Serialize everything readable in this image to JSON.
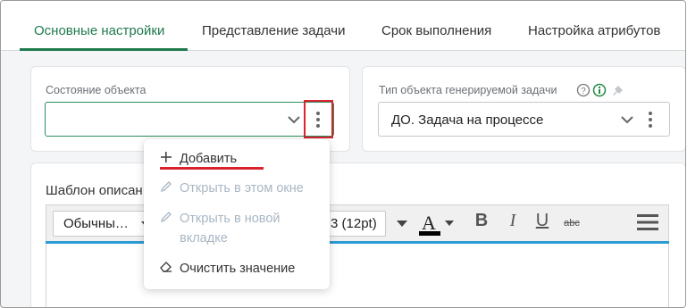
{
  "tabs": [
    {
      "label": "Основные настройки",
      "active": true
    },
    {
      "label": "Представление задачи",
      "active": false
    },
    {
      "label": "Срок выполнения",
      "active": false
    },
    {
      "label": "Настройка атрибутов",
      "active": false
    }
  ],
  "object_state": {
    "label": "Состояние объекта",
    "value": ""
  },
  "task_type": {
    "label": "Тип объекта генерируемой задачи",
    "value": "ДО. Задача на процессе"
  },
  "template": {
    "label": "Шаблон описан"
  },
  "editor_toolbar": {
    "style_value": "Обычны…",
    "size_value": "3 (12pt)",
    "font_color_letter": "A",
    "bold": "B",
    "italic": "I",
    "underline": "U",
    "strike": "abc"
  },
  "context_menu": {
    "items": [
      {
        "label": "Добавить",
        "icon": "plus-icon",
        "disabled": false
      },
      {
        "label": "Открыть в этом окне",
        "icon": "pencil-icon",
        "disabled": true
      },
      {
        "label": "Открыть в новой вкладке",
        "icon": "pencil-icon",
        "disabled": true
      },
      {
        "label": "Очистить значение",
        "icon": "eraser-icon",
        "disabled": false
      }
    ]
  },
  "colors": {
    "accent_green": "#1f7a4d",
    "highlight_red": "#d9232d",
    "editor_accent_blue": "#2d9bd3",
    "disabled_text": "#a9b7c4"
  }
}
